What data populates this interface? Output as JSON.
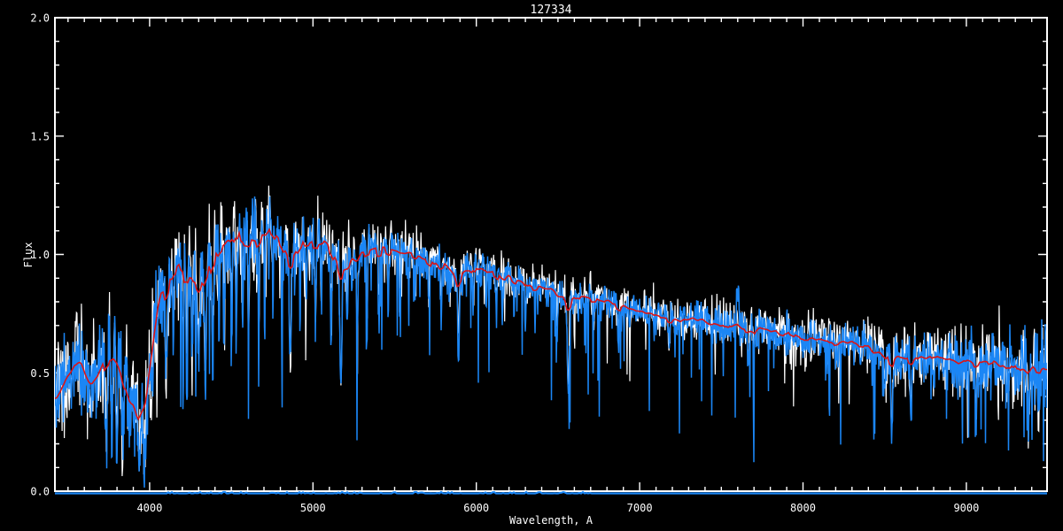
{
  "chart_data": {
    "type": "line",
    "title": "127334",
    "xlabel": "Wavelength, A",
    "ylabel": "Flux",
    "xlim": [
      3420,
      9494
    ],
    "ylim": [
      0.0,
      2.0
    ],
    "x_major_ticks": [
      4000,
      5000,
      6000,
      7000,
      8000,
      9000
    ],
    "x_tick_labels": [
      "4000",
      "5000",
      "6000",
      "7000",
      "8000",
      "9000"
    ],
    "x_minor_step": 100,
    "y_major_ticks": [
      0.0,
      0.5,
      1.0,
      1.5,
      2.0
    ],
    "y_tick_labels": [
      "0.0",
      "0.5",
      "1.0",
      "1.5",
      "2.0"
    ],
    "y_minor_step": 0.1,
    "grid": false,
    "legend": "none",
    "background_color": "#000000",
    "axis_color": "#ffffff",
    "series": [
      {
        "name": "observed-spectrum-white",
        "color": "#ffffff",
        "description": "noisy observed spectrum drawn behind"
      },
      {
        "name": "observed-spectrum-blue",
        "color": "#1b86f5",
        "description": "noisy spectrum with deep absorption lines drawn over the white one"
      },
      {
        "name": "model-fit-red",
        "color": "#dd1414",
        "description": "smooth red template/fit tracing the continuum"
      },
      {
        "name": "error-spectrum-blue",
        "color": "#1b86f5",
        "baseline_flux": 0.0,
        "description": "flat blue line along flux = 0 at the bottom axis"
      }
    ],
    "continuum_points": [
      [
        3420,
        0.38
      ],
      [
        3450,
        0.42
      ],
      [
        3480,
        0.46
      ],
      [
        3510,
        0.5
      ],
      [
        3545,
        0.53
      ],
      [
        3575,
        0.55
      ],
      [
        3605,
        0.49
      ],
      [
        3630,
        0.44
      ],
      [
        3660,
        0.46
      ],
      [
        3695,
        0.51
      ],
      [
        3730,
        0.56
      ],
      [
        3765,
        0.59
      ],
      [
        3790,
        0.6
      ],
      [
        3815,
        0.55
      ],
      [
        3845,
        0.46
      ],
      [
        3875,
        0.39
      ],
      [
        3905,
        0.35
      ],
      [
        3935,
        0.33
      ],
      [
        3965,
        0.38
      ],
      [
        3990,
        0.46
      ],
      [
        4015,
        0.58
      ],
      [
        4040,
        0.74
      ],
      [
        4070,
        0.85
      ],
      [
        4100,
        0.84
      ],
      [
        4130,
        0.9
      ],
      [
        4160,
        0.95
      ],
      [
        4190,
        0.96
      ],
      [
        4220,
        0.92
      ],
      [
        4250,
        0.93
      ],
      [
        4285,
        0.88
      ],
      [
        4315,
        0.89
      ],
      [
        4345,
        0.92
      ],
      [
        4380,
        0.97
      ],
      [
        4420,
        1.02
      ],
      [
        4460,
        1.06
      ],
      [
        4500,
        1.08
      ],
      [
        4540,
        1.1
      ],
      [
        4580,
        1.07
      ],
      [
        4620,
        1.07
      ],
      [
        4660,
        1.06
      ],
      [
        4700,
        1.09
      ],
      [
        4740,
        1.11
      ],
      [
        4780,
        1.08
      ],
      [
        4820,
        1.03
      ],
      [
        4861,
        0.97
      ],
      [
        4900,
        1.02
      ],
      [
        4940,
        1.05
      ],
      [
        4980,
        1.05
      ],
      [
        5020,
        1.04
      ],
      [
        5060,
        1.07
      ],
      [
        5100,
        1.03
      ],
      [
        5140,
        0.98
      ],
      [
        5180,
        0.94
      ],
      [
        5220,
        0.98
      ],
      [
        5260,
        0.99
      ],
      [
        5300,
        1.01
      ],
      [
        5350,
        1.02
      ],
      [
        5400,
        1.02
      ],
      [
        5450,
        1.03
      ],
      [
        5500,
        1.02
      ],
      [
        5560,
        1.01
      ],
      [
        5620,
        1.0
      ],
      [
        5680,
        0.98
      ],
      [
        5740,
        0.96
      ],
      [
        5800,
        0.96
      ],
      [
        5850,
        0.93
      ],
      [
        5890,
        0.89
      ],
      [
        5930,
        0.93
      ],
      [
        5970,
        0.94
      ],
      [
        6020,
        0.94
      ],
      [
        6080,
        0.93
      ],
      [
        6140,
        0.91
      ],
      [
        6200,
        0.9
      ],
      [
        6260,
        0.89
      ],
      [
        6320,
        0.87
      ],
      [
        6380,
        0.86
      ],
      [
        6440,
        0.86
      ],
      [
        6500,
        0.83
      ],
      [
        6563,
        0.8
      ],
      [
        6610,
        0.82
      ],
      [
        6660,
        0.82
      ],
      [
        6720,
        0.81
      ],
      [
        6780,
        0.8
      ],
      [
        6840,
        0.79
      ],
      [
        6900,
        0.78
      ],
      [
        6960,
        0.77
      ],
      [
        7020,
        0.76
      ],
      [
        7080,
        0.75
      ],
      [
        7140,
        0.73
      ],
      [
        7200,
        0.72
      ],
      [
        7260,
        0.72
      ],
      [
        7320,
        0.73
      ],
      [
        7380,
        0.72
      ],
      [
        7440,
        0.71
      ],
      [
        7500,
        0.7
      ],
      [
        7560,
        0.7
      ],
      [
        7620,
        0.69
      ],
      [
        7680,
        0.68
      ],
      [
        7740,
        0.69
      ],
      [
        7800,
        0.68
      ],
      [
        7860,
        0.67
      ],
      [
        7920,
        0.66
      ],
      [
        7980,
        0.65
      ],
      [
        8040,
        0.64
      ],
      [
        8100,
        0.64
      ],
      [
        8160,
        0.63
      ],
      [
        8220,
        0.62
      ],
      [
        8280,
        0.63
      ],
      [
        8340,
        0.62
      ],
      [
        8400,
        0.61
      ],
      [
        8460,
        0.59
      ],
      [
        8520,
        0.57
      ],
      [
        8580,
        0.57
      ],
      [
        8640,
        0.56
      ],
      [
        8700,
        0.57
      ],
      [
        8760,
        0.57
      ],
      [
        8820,
        0.57
      ],
      [
        8880,
        0.56
      ],
      [
        8940,
        0.55
      ],
      [
        9000,
        0.55
      ],
      [
        9060,
        0.54
      ],
      [
        9120,
        0.55
      ],
      [
        9180,
        0.54
      ],
      [
        9240,
        0.53
      ],
      [
        9300,
        0.52
      ],
      [
        9360,
        0.52
      ],
      [
        9420,
        0.52
      ],
      [
        9494,
        0.51
      ]
    ],
    "absorption_lines_format": [
      "center_wavelength_A",
      "bottom_flux",
      "sigma_A"
    ],
    "absorption_lines": [
      [
        3735,
        0.15,
        6
      ],
      [
        3770,
        0.28,
        5
      ],
      [
        3800,
        0.22,
        5
      ],
      [
        3835,
        0.16,
        6
      ],
      [
        3870,
        0.26,
        5
      ],
      [
        3935,
        0.1,
        7
      ],
      [
        3970,
        0.13,
        7
      ],
      [
        4026,
        0.6,
        3
      ],
      [
        4045,
        0.55,
        3
      ],
      [
        4101,
        0.45,
        5
      ],
      [
        4145,
        0.6,
        3
      ],
      [
        4205,
        0.42,
        3
      ],
      [
        4227,
        0.34,
        4
      ],
      [
        4260,
        0.52,
        3
      ],
      [
        4300,
        0.52,
        6
      ],
      [
        4340,
        0.5,
        5
      ],
      [
        4385,
        0.56,
        4
      ],
      [
        4425,
        0.62,
        3
      ],
      [
        4455,
        0.66,
        3
      ],
      [
        4500,
        0.6,
        3
      ],
      [
        4530,
        0.6,
        3
      ],
      [
        4570,
        0.7,
        3
      ],
      [
        4605,
        0.62,
        3
      ],
      [
        4668,
        0.66,
        4
      ],
      [
        4705,
        0.72,
        3
      ],
      [
        4755,
        0.75,
        3
      ],
      [
        4810,
        0.72,
        3
      ],
      [
        4861,
        0.55,
        5
      ],
      [
        4920,
        0.72,
        3
      ],
      [
        4958,
        0.8,
        3
      ],
      [
        5015,
        0.7,
        3
      ],
      [
        5050,
        0.78,
        3
      ],
      [
        5110,
        0.64,
        3
      ],
      [
        5170,
        0.46,
        6
      ],
      [
        5210,
        0.68,
        3
      ],
      [
        5270,
        0.62,
        4
      ],
      [
        5330,
        0.68,
        3
      ],
      [
        5405,
        0.7,
        3
      ],
      [
        5460,
        0.74,
        3
      ],
      [
        5530,
        0.74,
        3
      ],
      [
        5625,
        0.76,
        3
      ],
      [
        5710,
        0.74,
        3
      ],
      [
        5785,
        0.72,
        3
      ],
      [
        5890,
        0.55,
        5
      ],
      [
        5980,
        0.78,
        3
      ],
      [
        6060,
        0.78,
        3
      ],
      [
        6122,
        0.7,
        3
      ],
      [
        6160,
        0.72,
        3
      ],
      [
        6230,
        0.76,
        3
      ],
      [
        6300,
        0.7,
        3
      ],
      [
        6360,
        0.72,
        3
      ],
      [
        6430,
        0.76,
        3
      ],
      [
        6495,
        0.66,
        3
      ],
      [
        6563,
        0.36,
        5
      ],
      [
        6620,
        0.74,
        3
      ],
      [
        6717,
        0.7,
        3
      ],
      [
        6870,
        0.6,
        4
      ],
      [
        6940,
        0.7,
        3
      ],
      [
        7050,
        0.68,
        3
      ],
      [
        7180,
        0.6,
        4
      ],
      [
        7240,
        0.68,
        3
      ],
      [
        7450,
        0.66,
        3
      ],
      [
        7665,
        0.54,
        4
      ],
      [
        7699,
        0.56,
        4
      ],
      [
        7890,
        0.6,
        3
      ],
      [
        8015,
        0.56,
        3
      ],
      [
        8200,
        0.52,
        4
      ],
      [
        8350,
        0.52,
        3
      ],
      [
        8430,
        0.54,
        3
      ],
      [
        8498,
        0.42,
        4
      ],
      [
        8542,
        0.21,
        5
      ],
      [
        8600,
        0.5,
        3
      ],
      [
        8662,
        0.33,
        5
      ],
      [
        8750,
        0.48,
        3
      ],
      [
        8800,
        0.44,
        3
      ],
      [
        8880,
        0.46,
        3
      ],
      [
        8950,
        0.47,
        3
      ],
      [
        9060,
        0.36,
        4
      ],
      [
        9150,
        0.4,
        3
      ],
      [
        9245,
        0.42,
        3
      ],
      [
        9320,
        0.43,
        3
      ],
      [
        9380,
        0.24,
        4
      ],
      [
        9440,
        0.3,
        3
      ]
    ],
    "emission_spike": {
      "center": 7600,
      "peak_flux": 0.86,
      "sigma": 6
    },
    "noise_envelope": [
      [
        3420,
        0.09
      ],
      [
        3950,
        0.095
      ],
      [
        4010,
        0.085
      ],
      [
        4400,
        0.08
      ],
      [
        4800,
        0.07
      ],
      [
        5100,
        0.055
      ],
      [
        5500,
        0.045
      ],
      [
        5900,
        0.038
      ],
      [
        6400,
        0.033
      ],
      [
        7000,
        0.033
      ],
      [
        7500,
        0.036
      ],
      [
        8000,
        0.04
      ],
      [
        8400,
        0.046
      ],
      [
        8800,
        0.055
      ],
      [
        9100,
        0.065
      ],
      [
        9300,
        0.075
      ],
      [
        9494,
        0.09
      ]
    ]
  }
}
